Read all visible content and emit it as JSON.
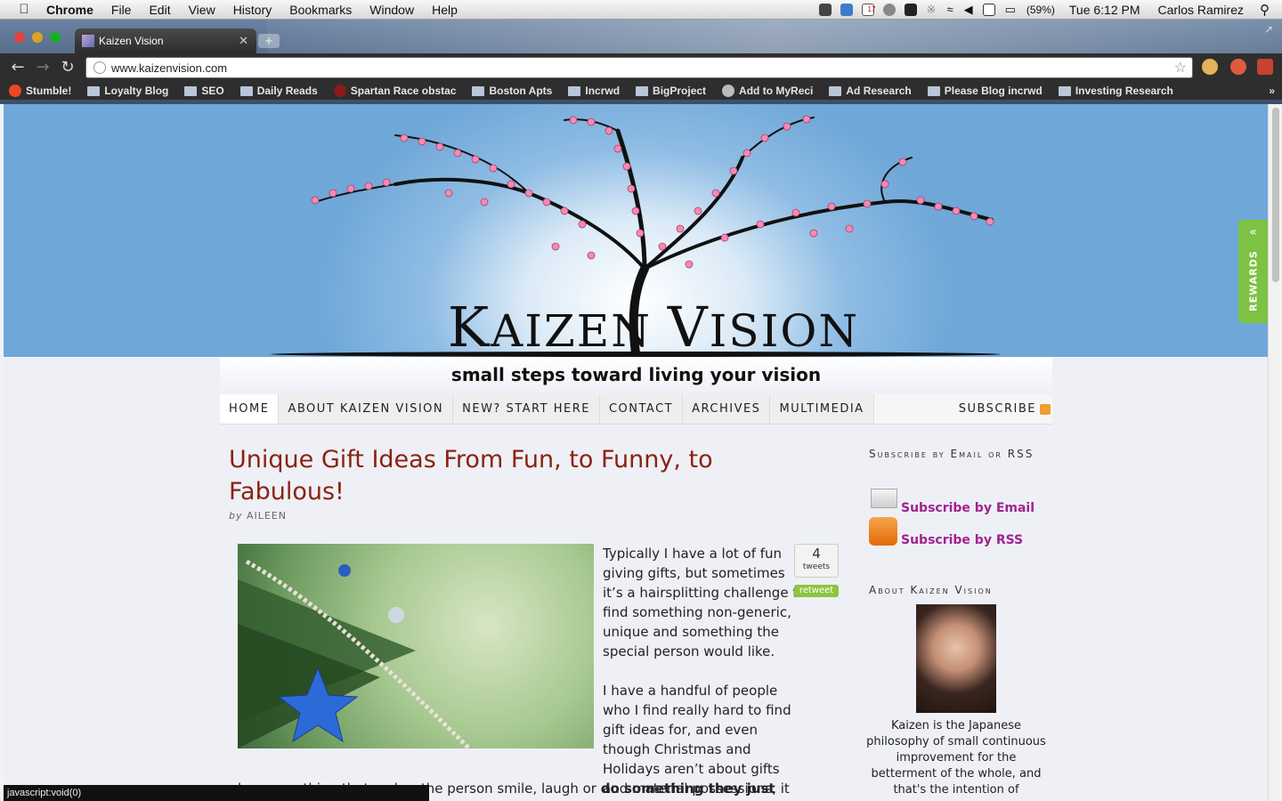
{
  "menubar": {
    "app": "Chrome",
    "items": [
      "File",
      "Edit",
      "View",
      "History",
      "Bookmarks",
      "Window",
      "Help"
    ],
    "battery": "(59%)",
    "clock": "Tue 6:12 PM",
    "user": "Carlos Ramirez",
    "calendar_day": "17"
  },
  "browser": {
    "tab_title": "Kaizen Vision",
    "url": "www.kaizenvision.com",
    "bookmarks": [
      "Stumble!",
      "Loyalty Blog",
      "SEO",
      "Daily Reads",
      "Spartan Race obstac",
      "Boston Apts",
      "Incrwd",
      "BigProject",
      "Add to MyReci",
      "Ad Research",
      "Please Blog incrwd",
      "Investing Research"
    ],
    "status": "javascript:void(0)"
  },
  "site": {
    "brand_a": "K",
    "brand_b": "AIZEN ",
    "brand_c": "V",
    "brand_d": "ISION",
    "tagline": "small steps toward living your vision",
    "nav": [
      "HOME",
      "ABOUT KAIZEN VISION",
      "NEW? START HERE",
      "CONTACT",
      "ARCHIVES",
      "MULTIMEDIA"
    ],
    "subscribe": "SUBSCRIBE",
    "rewards": "REWARDS"
  },
  "post": {
    "title": "Unique Gift Ideas From Fun, to Funny, to Fabulous!",
    "by": "by",
    "author": "AILEEN",
    "p1": "Typically I have a lot of fun giving gifts, but sometimes it’s a hairsplitting challenge to find something non-generic, unique and something the special person would like.",
    "p2": "I have a handful of people who I find really hard to find gift ideas for, and even though Christmas and Holidays aren’t about gifts and material possessions, it can be great fun to",
    "p3_start": "buy something that makes the person smile, laugh or ",
    "p3_bold": "do something they just wouldn’t",
    "tweet_count": "4",
    "tweet_label": "tweets",
    "retweet": "retweet"
  },
  "sidebar": {
    "subscribe_heading": "Subscribe by Email or RSS",
    "email_link": "Subscribe by Email",
    "rss_link": "Subscribe by RSS",
    "about_heading": "About Kaizen Vision",
    "about_text": "Kaizen is the Japanese philosophy of small continuous improvement for the betterment of the whole, and that's the intention of"
  }
}
